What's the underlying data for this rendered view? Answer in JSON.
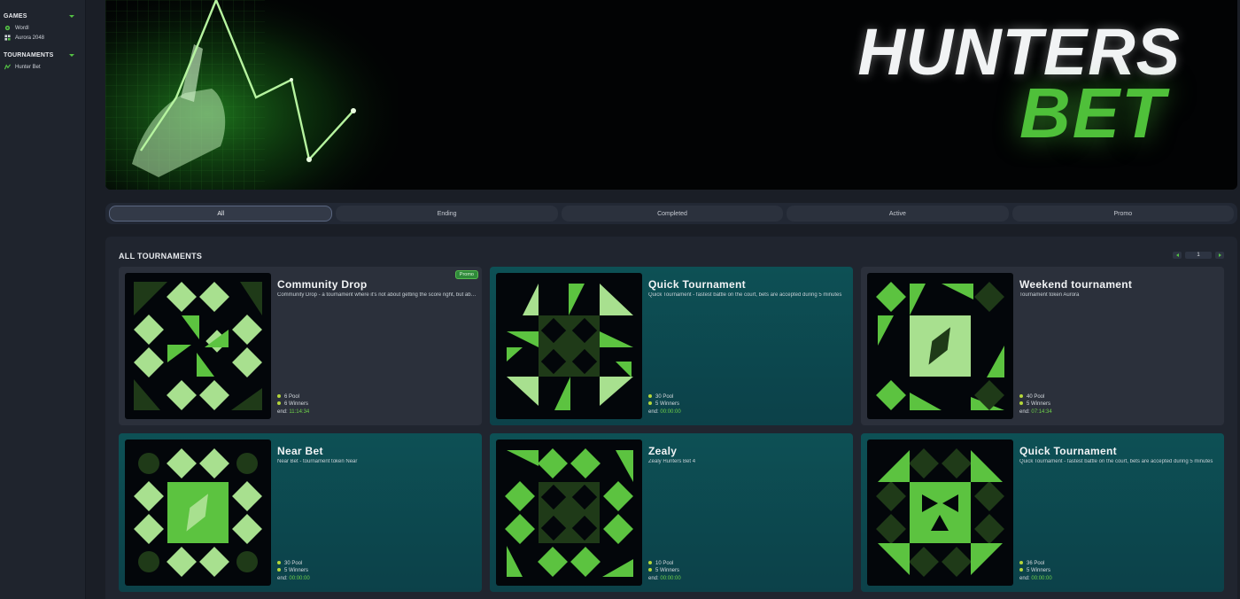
{
  "sidebar": {
    "games_label": "GAMES",
    "games": [
      {
        "label": "Wordl",
        "icon": "globe-icon"
      },
      {
        "label": "Aurora 2048",
        "icon": "grid-icon"
      }
    ],
    "tournaments_label": "TOURNAMENTS",
    "tournaments": [
      {
        "label": "Hunter Bet",
        "icon": "chart-icon"
      }
    ]
  },
  "banner": {
    "logo_line1": "HUNTERS",
    "logo_line2": "BET"
  },
  "filters": [
    "All",
    "Ending",
    "Completed",
    "Active",
    "Promo"
  ],
  "active_filter": "All",
  "tournaments": {
    "section_title": "ALL TOURNAMENTS",
    "page": "1",
    "cards": [
      {
        "title": "Community Drop",
        "desc": "Community Drop - a tournament where it's not about getting the score right, but about participating",
        "pool": "6 Pool",
        "winners": "6 Winners",
        "end_label": "end:",
        "end_value": "11:14:34",
        "badge": "Promo",
        "theme": "gray"
      },
      {
        "title": "Quick Tournament",
        "desc": "Quick Tournament - fastest battle on the court, bets are accepted during 5 minutes",
        "pool": "30 Pool",
        "winners": "5 Winners",
        "end_label": "end:",
        "end_value": "00:00:00",
        "badge": "",
        "theme": "teal"
      },
      {
        "title": "Weekend tournament",
        "desc": "Tournament token Aurora",
        "pool": "40 Pool",
        "winners": "5 Winners",
        "end_label": "end:",
        "end_value": "07:14:34",
        "badge": "",
        "theme": "gray"
      },
      {
        "title": "Near Bet",
        "desc": "Near Bet - tournament token Near",
        "pool": "30 Pool",
        "winners": "5 Winners",
        "end_label": "end:",
        "end_value": "00:00:00",
        "badge": "",
        "theme": "teal"
      },
      {
        "title": "Zealy",
        "desc": "Zealy Hunters Bet 4",
        "pool": "10 Pool",
        "winners": "5 Winners",
        "end_label": "end:",
        "end_value": "00:00:00",
        "badge": "",
        "theme": "teal"
      },
      {
        "title": "Quick Tournament",
        "desc": "Quick Tournament - fastest battle on the court, bets are accepted during 5 minutes",
        "pool": "36 Pool",
        "winners": "5 Winners",
        "end_label": "end:",
        "end_value": "00:00:00",
        "badge": "",
        "theme": "teal"
      }
    ]
  },
  "colors": {
    "accent_green": "#54c244",
    "light_green": "#a8e08f",
    "dark_green": "#1f3a18",
    "teal_card": "#0d5055",
    "gray_card": "#2b303b"
  }
}
